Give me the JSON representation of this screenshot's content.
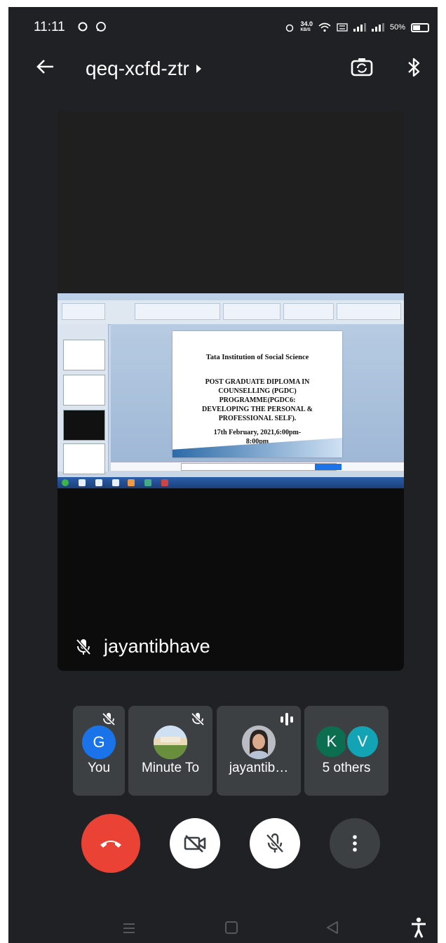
{
  "status_bar": {
    "time": "11:11",
    "speed_value": "34.0",
    "speed_unit": "KB/S",
    "battery": "50%"
  },
  "header": {
    "meeting_code": "qeq-xcfd-ztr"
  },
  "presentation": {
    "institution": "Tata Institution of Social Science",
    "programme_lines": [
      "POST GRADUATE DIPLOMA IN",
      "COUNSELLING (PGDC)",
      "PROGRAMME(PGDC6:",
      "DEVELOPING THE PERSONAL &",
      "PROFESSIONAL SELF)."
    ],
    "date_line1": "17th February, 2021,6:00pm-",
    "date_line2": "8:00pm",
    "presenter_name": "jayantibhave"
  },
  "participants": [
    {
      "label": "You",
      "avatar_letter": "G",
      "avatar_color": "#1a73e8",
      "muted": true
    },
    {
      "label": "Minute To",
      "muted": true
    },
    {
      "label": "jayantib…",
      "speaking": true
    },
    {
      "label": "5 others",
      "avatars": [
        "K",
        "V"
      ],
      "avatar_colors": [
        "#0b6e4f",
        "#12a4b4"
      ]
    }
  ],
  "controls": {
    "end_call_color": "#ea4335"
  },
  "colors": {
    "background": "#202124",
    "tile": "#3c4043",
    "accent": "#1a73e8"
  }
}
